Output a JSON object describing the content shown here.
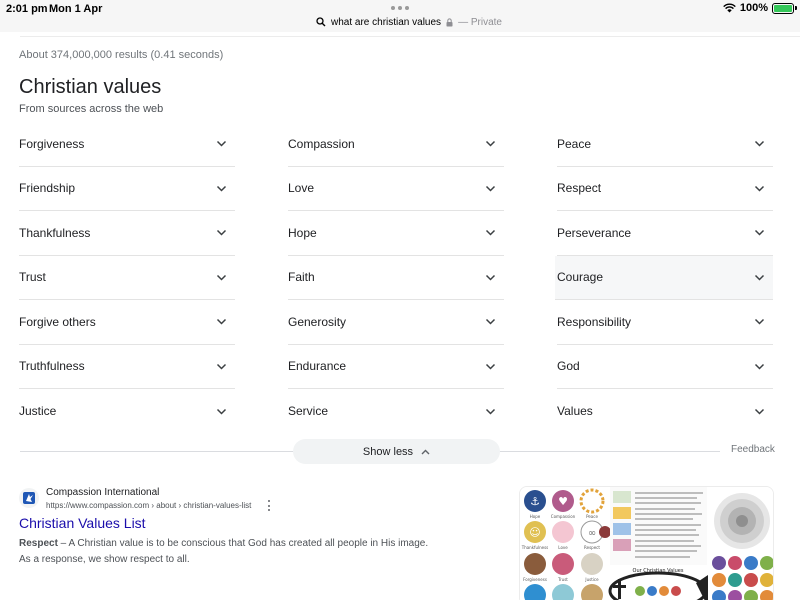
{
  "status_bar": {
    "time": "2:01 pm",
    "date": "Mon 1 Apr",
    "url": "what are christian values",
    "private_label": "— Private",
    "battery": "100%"
  },
  "search": {
    "result_stats": "About 374,000,000 results (0.41 seconds)"
  },
  "knowledge_panel": {
    "title": "Christian values",
    "subtitle": "From sources across the web",
    "columns": [
      [
        "Forgiveness",
        "Friendship",
        "Thankfulness",
        "Trust",
        "Forgive others",
        "Truthfulness",
        "Justice"
      ],
      [
        "Compassion",
        "Love",
        "Hope",
        "Faith",
        "Generosity",
        "Endurance",
        "Service"
      ],
      [
        "Peace",
        "Respect",
        "Perseverance",
        "Courage",
        "Responsibility",
        "God",
        "Values"
      ]
    ],
    "show_less_label": "Show less",
    "feedback_label": "Feedback"
  },
  "result": {
    "site_name": "Compassion International",
    "site_url": "https://www.compassion.com › about › christian-values-list",
    "title": "Christian Values List",
    "snippet_bold": "Respect",
    "snippet_text": " – A Christian value is to be conscious that God has created all people in His image. As a response, we show respect to all."
  },
  "image_text": {
    "hope": "Hope",
    "compassion": "Compassion",
    "peace": "Peace",
    "thankfulness": "Thankfulness",
    "love": "Love",
    "respect": "Respect",
    "forgiveness": "Forgiveness",
    "trust": "Trust",
    "justice": "Justice",
    "our_christian_values": "Our Christian Values"
  },
  "colors": {
    "link": "#1a0dab",
    "battery_fill": "#34c759",
    "highlight_row": "#f6f7f8"
  }
}
